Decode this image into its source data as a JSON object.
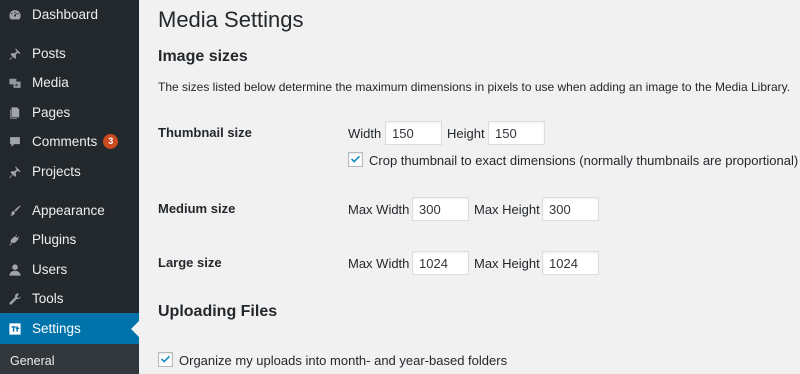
{
  "sidebar": {
    "items": [
      {
        "label": "Dashboard",
        "icon": "dashboard-icon"
      },
      {
        "label": "Posts",
        "icon": "pin-icon"
      },
      {
        "label": "Media",
        "icon": "media-icon"
      },
      {
        "label": "Pages",
        "icon": "pages-icon"
      },
      {
        "label": "Comments",
        "icon": "comment-icon",
        "badge": "3"
      },
      {
        "label": "Projects",
        "icon": "pin-icon"
      },
      {
        "label": "Appearance",
        "icon": "paintbrush-icon"
      },
      {
        "label": "Plugins",
        "icon": "plug-icon"
      },
      {
        "label": "Users",
        "icon": "user-icon"
      },
      {
        "label": "Tools",
        "icon": "wrench-icon"
      },
      {
        "label": "Settings",
        "icon": "settings-icon",
        "active": true
      }
    ],
    "submenu": {
      "label": "General"
    },
    "colors": {
      "background": "#23282d",
      "active": "#0073aa",
      "badge": "#ca4a1f"
    }
  },
  "main": {
    "title": "Media Settings",
    "image_sizes": {
      "heading": "Image sizes",
      "description": "The sizes listed below determine the maximum dimensions in pixels to use when adding an image to the Media Library.",
      "thumbnail": {
        "label": "Thumbnail size",
        "width_label": "Width",
        "width_value": "150",
        "height_label": "Height",
        "height_value": "150",
        "crop_label": "Crop thumbnail to exact dimensions (normally thumbnails are proportional)",
        "crop_checked": true
      },
      "medium": {
        "label": "Medium size",
        "width_label": "Max Width",
        "width_value": "300",
        "height_label": "Max Height",
        "height_value": "300"
      },
      "large": {
        "label": "Large size",
        "width_label": "Max Width",
        "width_value": "1024",
        "height_label": "Max Height",
        "height_value": "1024"
      }
    },
    "uploading": {
      "heading": "Uploading Files",
      "organize_label": "Organize my uploads into month- and year-based folders",
      "organize_checked": true
    }
  }
}
